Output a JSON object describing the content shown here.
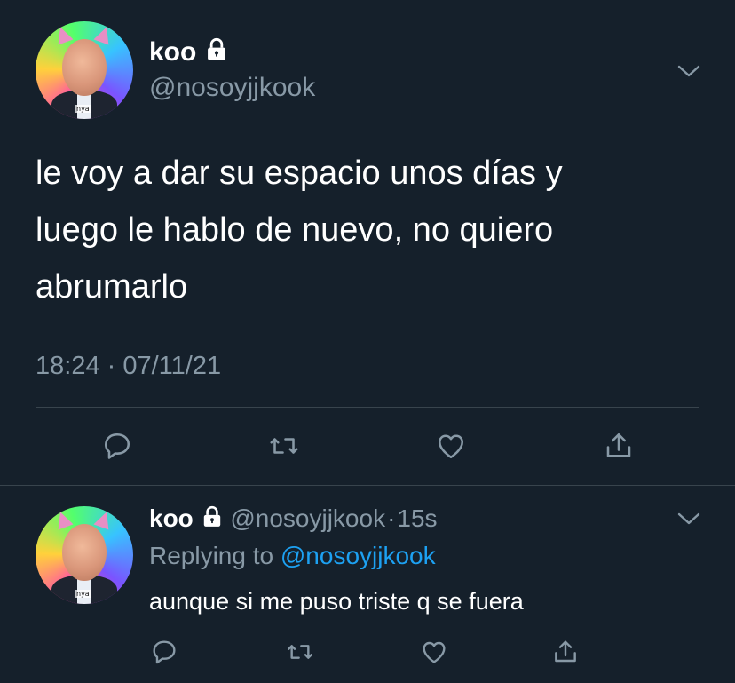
{
  "main_tweet": {
    "author_name": "koo",
    "author_handle": "@nosoyjjkook",
    "avatar_tag": "nya",
    "text_lines": [
      "le voy a dar su espacio unos días y",
      "luego le hablo de nuevo, no quiero",
      "abrumarlo"
    ],
    "timestamp": "18:24 · 07/11/21"
  },
  "reply_tweet": {
    "author_name": "koo",
    "author_handle": "@nosoyjjkook",
    "time_sep": "·",
    "time": "15s",
    "replying_prefix": "Replying to",
    "replying_handle": "@nosoyjjkook",
    "avatar_tag": "nya",
    "text": "aunque si me puso triste q se fuera"
  },
  "icons": [
    "lock-icon",
    "chevron-down-icon",
    "reply-icon",
    "retweet-icon",
    "like-icon",
    "share-icon"
  ],
  "colors": {
    "background": "#15202b",
    "secondary_text": "#8899a6",
    "link": "#1da1f2",
    "divider": "#38444d"
  }
}
